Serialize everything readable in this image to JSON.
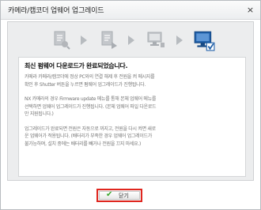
{
  "window": {
    "title": "카메라/캠코더 업웨어 업그레이드",
    "close_glyph": "×"
  },
  "steps": [
    {
      "icon": "document-icon",
      "state": "inactive"
    },
    {
      "icon": "document-icon",
      "state": "inactive"
    },
    {
      "icon": "computer-icon",
      "state": "inactive"
    },
    {
      "icon": "computer-check-icon",
      "state": "active"
    }
  ],
  "colors": {
    "active_step": "#1f5fa8",
    "inactive_step": "#a9adb2",
    "button_highlight": "#e0261f",
    "check": "#3aa62c"
  },
  "message": {
    "headline": "최신 펌웨어 다운로드가 완료되었습니다.",
    "paragraphs": [
      [
        "카메라 카메라/캠코더에 정상 PC와의 연결 해제 후 전원을 켜 메시지를",
        "확인 후 Shutter 버튼을 누르면 펌웨어 업그레이드가 진행됩니다."
      ],
      [
        "NX 카메라의 경우 Firmware update 메뉴를 통해 본체 업웨어 메뉴를",
        "선택하면 업웨어 업그레이드가 진행됩니다. (본체 업웨어 파일 다운로드",
        "만 지원됩니다.)"
      ],
      [
        "업그레이드가 완료되면 전원은 자동으로 꺼지고, 전원을 다시 켜면 새로",
        "운 업웨어가 적용됩니다. (배터리가 부족한 경우 업웨어 업그레이드가",
        "불가능하며, 설치 중에는 배터리를 빼거나 전원을 끄지 마세요.)"
      ]
    ]
  },
  "footer": {
    "close_label": "닫기",
    "check_glyph": "✔"
  }
}
